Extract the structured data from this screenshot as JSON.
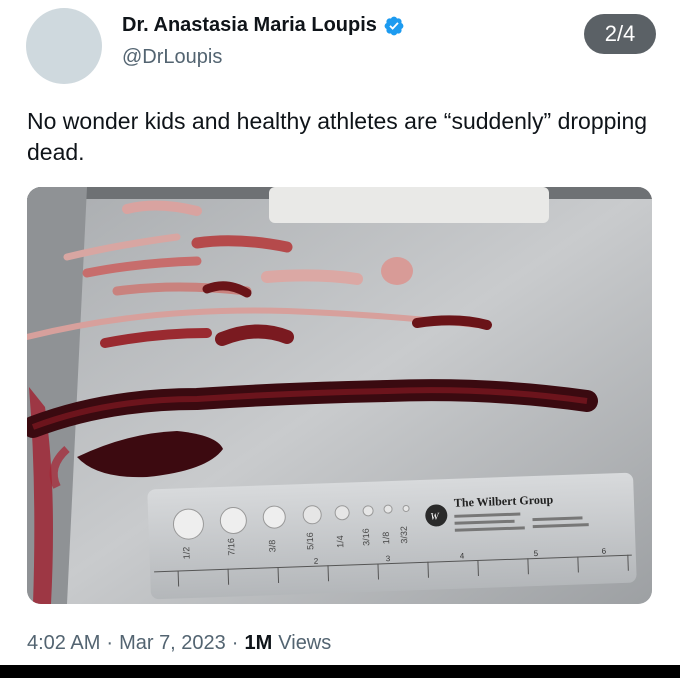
{
  "author": {
    "display_name": "Dr. Anastasia Maria Loupis",
    "handle": "@DrLoupis",
    "verified_color": "#1d9bf0"
  },
  "media_counter": "2/4",
  "tweet": {
    "text": "No wonder kids and healthy athletes are “suddenly” dropping dead."
  },
  "image": {
    "ruler": {
      "brand": "The Wilbert Group",
      "sizes": [
        "1/2",
        "7/16",
        "3/8",
        "5/16",
        "1/4",
        "3/16",
        "1/8",
        "3/32"
      ],
      "numbers": [
        "2",
        "3",
        "4",
        "5",
        "6"
      ]
    }
  },
  "meta": {
    "time": "4:02 AM",
    "date": "Mar 7, 2023",
    "views_count": "1M",
    "views_label": "Views"
  }
}
